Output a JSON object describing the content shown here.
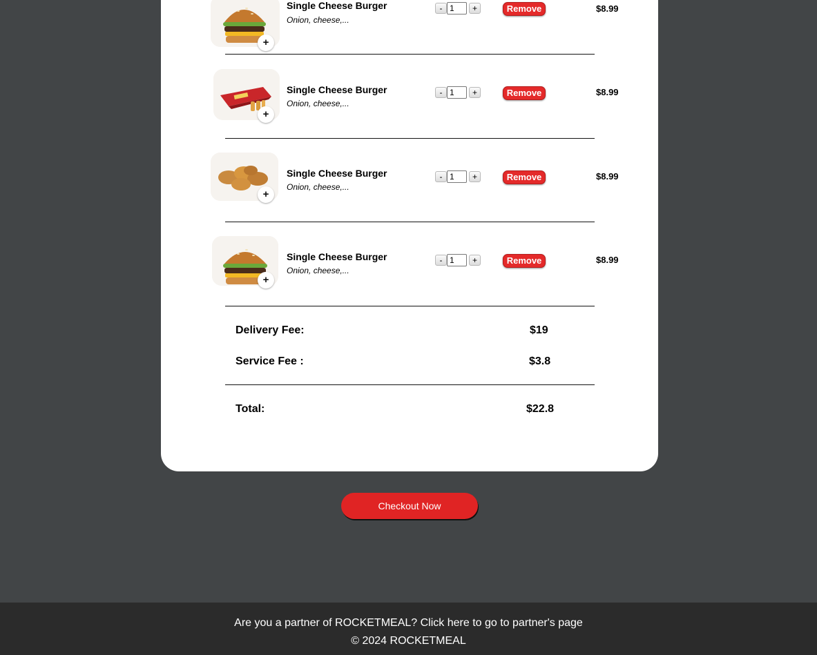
{
  "cart": {
    "items": [
      {
        "name": "Single Cheese Burger",
        "description": "Onion, cheese,...",
        "quantity": "1",
        "minus_label": "-",
        "plus_label": "+",
        "remove_label": "Remove",
        "price": "$8.99",
        "image": "burger-image",
        "badge": "+"
      },
      {
        "name": "Single Cheese Burger",
        "description": "Onion, cheese,...",
        "quantity": "1",
        "minus_label": "-",
        "plus_label": "+",
        "remove_label": "Remove",
        "price": "$8.99",
        "image": "fries-bag-image",
        "badge": "+"
      },
      {
        "name": "Single Cheese Burger",
        "description": "Onion, cheese,...",
        "quantity": "1",
        "minus_label": "-",
        "plus_label": "+",
        "remove_label": "Remove",
        "price": "$8.99",
        "image": "nuggets-image",
        "badge": "+"
      },
      {
        "name": "Single Cheese Burger",
        "description": "Onion, cheese,...",
        "quantity": "1",
        "minus_label": "-",
        "plus_label": "+",
        "remove_label": "Remove",
        "price": "$8.99",
        "image": "burger-image",
        "badge": "+"
      }
    ],
    "delivery_fee_label": "Delivery Fee:",
    "delivery_fee_value": "$19",
    "service_fee_label": "Service Fee :",
    "service_fee_value": "$3.8",
    "total_label": "Total:",
    "total_value": "$22.8"
  },
  "checkout_label": "Checkout Now",
  "footer": {
    "partner_link": "Are you a partner of ROCKETMEAL? Click here to go to partner's page",
    "copyright": "© 2024 ROCKETMEAL"
  },
  "colors": {
    "background": "#424547",
    "card": "#ffffff",
    "accent_red": "#e02424",
    "footer": "#2b2b2b"
  }
}
